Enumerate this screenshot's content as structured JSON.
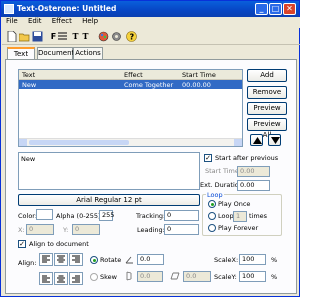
{
  "window": {
    "title": "Text-Osterone: Untitled"
  },
  "menu": [
    "File",
    "Edit",
    "Effect",
    "Help"
  ],
  "tabs": [
    "Text",
    "Document",
    "Actions"
  ],
  "list": {
    "columns": [
      "Text",
      "Effect",
      "Start Time"
    ],
    "rows": [
      {
        "text": "New",
        "effect": "Come Together",
        "start": "00.00.00"
      }
    ]
  },
  "side_buttons": {
    "add": "Add",
    "remove": "Remove",
    "preview": "Preview",
    "preview_all": "Preview All"
  },
  "text_content": "New",
  "font_button": "Arial Regular 12 pt",
  "color_label": "Color:",
  "alpha_label": "Alpha (0-255):",
  "alpha_value": "255",
  "tracking_label": "Tracking:",
  "tracking_value": "0",
  "leading_label": "Leading:",
  "leading_value": "0",
  "x_label": "X:",
  "x_value": "0",
  "y_label": "Y:",
  "y_value": "0",
  "align_doc_label": "Align to document",
  "align_label": "Align:",
  "timing": {
    "start_after_previous": "Start after previous",
    "start_time_label": "Start Time:",
    "start_time_value": "0.00",
    "ext_duration_label": "Ext. Duration:",
    "ext_duration_value": "0.00"
  },
  "loop": {
    "title": "Loop",
    "play_once": "Play Once",
    "loop": "Loop",
    "loop_times": "1",
    "times": "times",
    "play_forever": "Play Forever"
  },
  "transform": {
    "rotate": "Rotate",
    "rotate_value": "0.0",
    "skew": "Skew",
    "skew_value1": "0.0",
    "skew_value2": "0.0",
    "scale_x_label": "ScaleX:",
    "scale_x_value": "100",
    "scale_y_label": "ScaleY:",
    "scale_y_value": "100",
    "pct": "%"
  }
}
